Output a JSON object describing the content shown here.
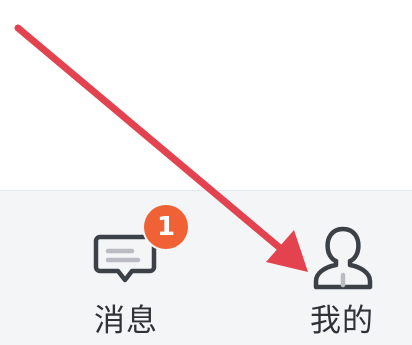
{
  "tabbar": {
    "messages": {
      "label": "消息",
      "icon": "chat-bubble-icon",
      "badge_count": "1"
    },
    "me": {
      "label": "我的",
      "icon": "user-profile-icon"
    }
  },
  "annotation": {
    "arrow_color": "#e3434f"
  },
  "colors": {
    "badge": "#f06236",
    "tabbar_bg": "#f3f5f7",
    "icon_stroke": "#3c4047"
  }
}
